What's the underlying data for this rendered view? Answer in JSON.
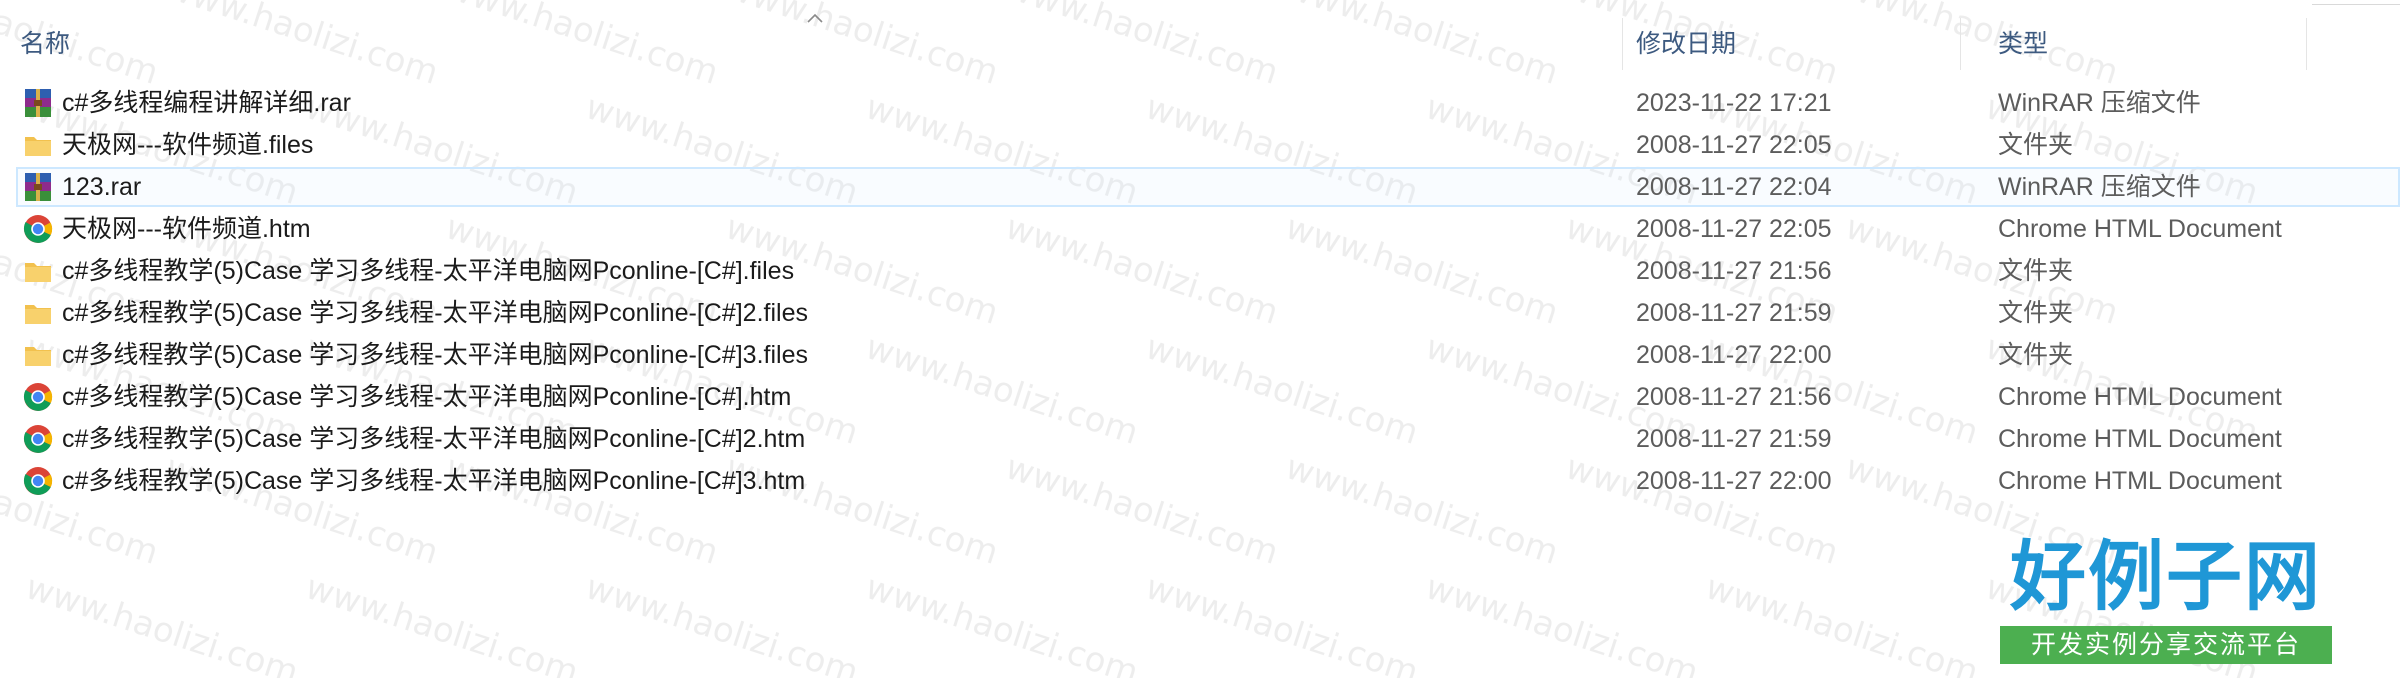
{
  "columns": {
    "name": "名称",
    "date": "修改日期",
    "type": "类型"
  },
  "files": [
    {
      "icon": "winrar-archive-icon",
      "name": "c#多线程编程讲解详细.rar",
      "date": "2023-11-22 17:21",
      "type": "WinRAR 压缩文件"
    },
    {
      "icon": "folder-icon",
      "name": "天极网---软件频道.files",
      "date": "2008-11-27 22:05",
      "type": "文件夹"
    },
    {
      "icon": "winrar-archive-icon",
      "name": "123.rar",
      "date": "2008-11-27 22:04",
      "type": "WinRAR 压缩文件",
      "selected": true
    },
    {
      "icon": "chrome-html-icon",
      "name": "天极网---软件频道.htm",
      "date": "2008-11-27 22:05",
      "type": "Chrome HTML Document"
    },
    {
      "icon": "folder-icon",
      "name": "c#多线程教学(5)Case 学习多线程-太平洋电脑网Pconline-[C#].files",
      "date": "2008-11-27 21:56",
      "type": "文件夹"
    },
    {
      "icon": "folder-icon",
      "name": "c#多线程教学(5)Case 学习多线程-太平洋电脑网Pconline-[C#]2.files",
      "date": "2008-11-27 21:59",
      "type": "文件夹"
    },
    {
      "icon": "folder-icon",
      "name": "c#多线程教学(5)Case 学习多线程-太平洋电脑网Pconline-[C#]3.files",
      "date": "2008-11-27 22:00",
      "type": "文件夹"
    },
    {
      "icon": "chrome-html-icon",
      "name": "c#多线程教学(5)Case 学习多线程-太平洋电脑网Pconline-[C#].htm",
      "date": "2008-11-27 21:56",
      "type": "Chrome HTML Document"
    },
    {
      "icon": "chrome-html-icon",
      "name": "c#多线程教学(5)Case 学习多线程-太平洋电脑网Pconline-[C#]2.htm",
      "date": "2008-11-27 21:59",
      "type": "Chrome HTML Document"
    },
    {
      "icon": "chrome-html-icon",
      "name": "c#多线程教学(5)Case 学习多线程-太平洋电脑网Pconline-[C#]3.htm",
      "date": "2008-11-27 22:00",
      "type": "Chrome HTML Document"
    }
  ],
  "watermark": {
    "text": "www.haolizi.com"
  },
  "logo": {
    "title": "好例子网",
    "tagline": "开发实例分享交流平台"
  },
  "colors": {
    "header_text": "#3d5a80",
    "selection": "#cde8ff",
    "logo_blue": "#1f97d6",
    "logo_green": "#4caf50"
  }
}
